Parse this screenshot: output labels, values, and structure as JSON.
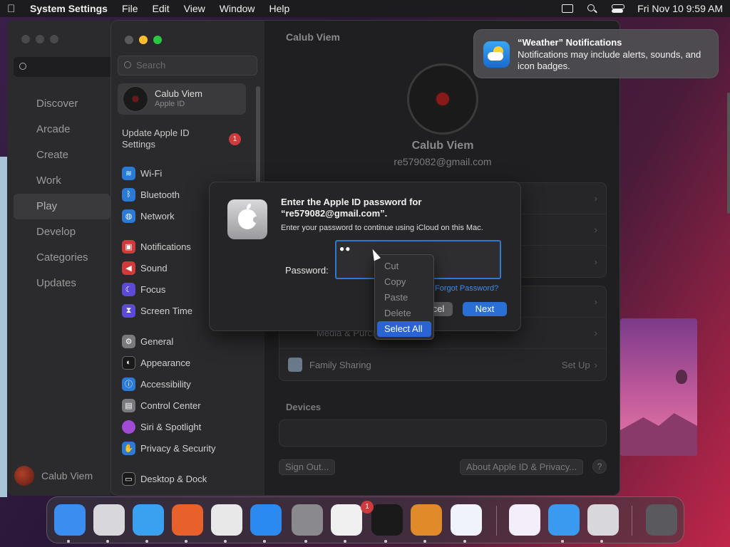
{
  "menubar": {
    "app": "System Settings",
    "items": [
      "File",
      "Edit",
      "View",
      "Window",
      "Help"
    ],
    "clock": "Fri Nov 10  9:59 AM"
  },
  "store": {
    "search_placeholder": "",
    "nav": [
      "Discover",
      "Arcade",
      "Create",
      "Work",
      "Play",
      "Develop",
      "Categories",
      "Updates"
    ],
    "active": "Play",
    "user": "Calub Viem"
  },
  "settings": {
    "search_placeholder": "Search",
    "account_name": "Calub Viem",
    "account_sub": "Apple ID",
    "update": "Update Apple ID Settings",
    "update_badge": "1",
    "sidebar": [
      {
        "label": "Wi-Fi",
        "color": "#2a7ad6",
        "glyph": "≋"
      },
      {
        "label": "Bluetooth",
        "color": "#2a7ad6",
        "glyph": "ᛒ"
      },
      {
        "label": "Network",
        "color": "#2a7ad6",
        "glyph": "◍"
      },
      {
        "label": "Notifications",
        "color": "#d03a3a",
        "glyph": "▣"
      },
      {
        "label": "Sound",
        "color": "#d03a3a",
        "glyph": "◀"
      },
      {
        "label": "Focus",
        "color": "#5a4ad6",
        "glyph": "☾"
      },
      {
        "label": "Screen Time",
        "color": "#5a4ad6",
        "glyph": "⧗"
      },
      {
        "label": "General",
        "color": "#7a7a7e",
        "glyph": "⚙"
      },
      {
        "label": "Appearance",
        "color": "#2a2a2c",
        "glyph": "◐"
      },
      {
        "label": "Accessibility",
        "color": "#2a7ad6",
        "glyph": "ⓘ"
      },
      {
        "label": "Control Center",
        "color": "#7a7a7e",
        "glyph": "▤"
      },
      {
        "label": "Siri & Spotlight",
        "color": "#a04ad6",
        "glyph": "●"
      },
      {
        "label": "Privacy & Security",
        "color": "#2a7ad6",
        "glyph": "✋"
      },
      {
        "label": "Desktop & Dock",
        "color": "#2a2a2c",
        "glyph": "▭"
      }
    ],
    "main_title": "Calub Viem",
    "profile_name": "Calub Viem",
    "profile_email": "re579082@gmail.com",
    "row_media": "Media & Purcha",
    "row_family": "Family Sharing",
    "row_family_trail": "Set Up",
    "devices_title": "Devices",
    "sign_out": "Sign Out...",
    "about": "About Apple ID & Privacy...",
    "help": "?"
  },
  "dialog": {
    "heading": "Enter the Apple ID password for “re579082@gmail.com”.",
    "subtext": "Enter your password to continue using iCloud on this Mac.",
    "password_label": "Password:",
    "password_value": "●●",
    "forgot": "Forgot Password?",
    "cancel": "cel",
    "next": "Next"
  },
  "context_menu": {
    "items": [
      "Cut",
      "Copy",
      "Paste",
      "Delete",
      "Select All"
    ],
    "selected": "Select All"
  },
  "notification": {
    "title": "“Weather” Notifications",
    "body": "Notifications may include alerts, sounds, and icon badges."
  },
  "dock": {
    "settings_badge": "1",
    "apps": [
      {
        "name": "finder-icon",
        "color": "#3a8ef0"
      },
      {
        "name": "launchpad-icon",
        "color": "#d8d8dc"
      },
      {
        "name": "safari-icon",
        "color": "#3aa0f0"
      },
      {
        "name": "firefox-icon",
        "color": "#e8602a"
      },
      {
        "name": "chrome-icon",
        "color": "#e8e8e8"
      },
      {
        "name": "app-store-icon",
        "color": "#2a8af0"
      },
      {
        "name": "system-settings-icon",
        "color": "#8a8a8e"
      },
      {
        "name": "textedit-icon",
        "color": "#f0f0f0"
      },
      {
        "name": "terminal-icon",
        "color": "#1a1a1a"
      },
      {
        "name": "garageband-icon",
        "color": "#e08a2a"
      },
      {
        "name": "vscode-icon",
        "color": "#f0f4fa"
      },
      {
        "name": "visual-studio-icon",
        "color": "#f4eefa"
      },
      {
        "name": "weather-icon",
        "color": "#3a9af0"
      },
      {
        "name": "calculator-icon",
        "color": "#d8d8dc"
      },
      {
        "name": "trash-icon",
        "color": "#5a5a5e"
      }
    ]
  }
}
